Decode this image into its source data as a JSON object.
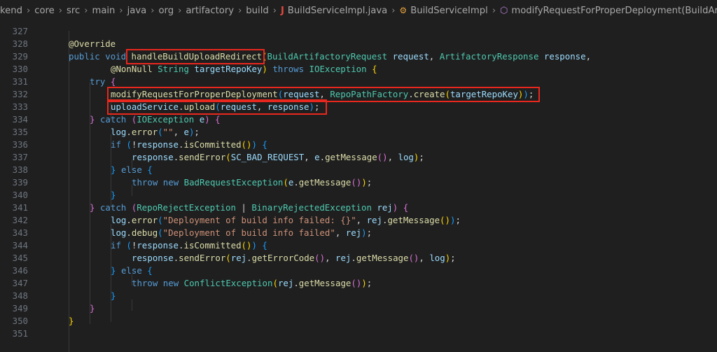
{
  "breadcrumb": {
    "items": [
      "kend",
      "core",
      "src",
      "main",
      "java",
      "org",
      "artifactory",
      "build"
    ],
    "file": "BuildServiceImpl.java",
    "class_name": "BuildServiceImpl",
    "method": "modifyRequestForProperDeployment(BuildArtifa"
  },
  "colors": {
    "background": "#1f1f1f",
    "highlight_box": "#e8281e",
    "line_number": "#6e7681"
  },
  "line_numbers": [
    "327",
    "328",
    "329",
    "330",
    "331",
    "332",
    "333",
    "334",
    "335",
    "336",
    "337",
    "338",
    "339",
    "340",
    "341",
    "342",
    "343",
    "344",
    "345",
    "346",
    "347",
    "348",
    "349",
    "350",
    "351"
  ],
  "code": {
    "l328": {
      "annotation": "@Override"
    },
    "l329": {
      "kw1": "public",
      "kw2": "void",
      "method": "handleBuildUploadRedirect",
      "t1": "BuildArtifactoryRequest",
      "p1": "request",
      "t2": "ArtifactoryResponse",
      "p2": "response"
    },
    "l330": {
      "ann": "@NonNull",
      "t1": "String",
      "p1": "targetRepoKey",
      "kw": "throws",
      "ex": "IOException"
    },
    "l331": {
      "kw": "try"
    },
    "l332": {
      "fn": "modifyRequestForProperDeployment",
      "a1": "request",
      "cls": "RepoPathFactory",
      "fn2": "create",
      "a2": "targetRepoKey"
    },
    "l333": {
      "obj": "uploadService",
      "fn": "upload",
      "a1": "request",
      "a2": "response"
    },
    "l334": {
      "kw": "catch",
      "ex": "IOException",
      "v": "e"
    },
    "l335": {
      "obj": "log",
      "fn": "error",
      "str": "\"\"",
      "v": "e"
    },
    "l336": {
      "kw": "if",
      "obj": "response",
      "fn": "isCommitted"
    },
    "l337": {
      "obj": "response",
      "fn": "sendError",
      "c": "SC_BAD_REQUEST",
      "v": "e",
      "fn2": "getMessage",
      "a": "log"
    },
    "l338": {
      "kw": "else"
    },
    "l339": {
      "kw1": "throw",
      "kw2": "new",
      "cls": "BadRequestException",
      "v": "e",
      "fn": "getMessage"
    },
    "l341": {
      "kw": "catch",
      "ex1": "RepoRejectException",
      "ex2": "BinaryRejectedException",
      "v": "rej"
    },
    "l342": {
      "obj": "log",
      "fn": "error",
      "str": "\"Deployment of build info failed: {}\"",
      "v": "rej",
      "fn2": "getMessage"
    },
    "l343": {
      "obj": "log",
      "fn": "debug",
      "str": "\"Deployment of build info failed\"",
      "v": "rej"
    },
    "l344": {
      "kw": "if",
      "obj": "response",
      "fn": "isCommitted"
    },
    "l345": {
      "obj": "response",
      "fn": "sendError",
      "v1": "rej",
      "fn2": "getErrorCode",
      "v2": "rej",
      "fn3": "getMessage",
      "a": "log"
    },
    "l346": {
      "kw": "else"
    },
    "l347": {
      "kw1": "throw",
      "kw2": "new",
      "cls": "ConflictException",
      "v": "rej",
      "fn": "getMessage"
    }
  }
}
